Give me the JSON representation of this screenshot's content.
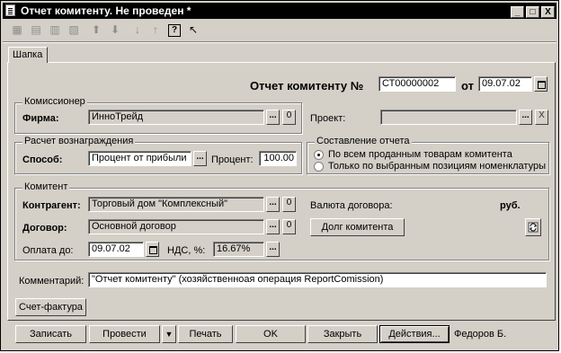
{
  "window": {
    "title": "Отчет комитенту. Не проведен *"
  },
  "title_buttons": [
    "_",
    "□",
    "X"
  ],
  "toolbar": {
    "icons": [
      "grid-icon",
      "grid-add-icon",
      "grid-copy-icon",
      "grid-delete-icon",
      "arrow-up-icon",
      "arrow-down-icon",
      "sort-asc-icon",
      "sort-desc-icon",
      "help-icon",
      "context-help-icon"
    ],
    "glyphs": [
      "▦",
      "▤",
      "▥",
      "▧",
      "⬆",
      "⬇",
      "↓",
      "↑",
      "?",
      "↖"
    ]
  },
  "tabs": {
    "main": "Шапка"
  },
  "doc": {
    "number_label": "Отчет комитенту №",
    "number": "СТ00000002",
    "from_label": "от",
    "date": "09.07.02"
  },
  "commissioner": {
    "group_label": "Комиссионер",
    "firm_label": "Фирма:",
    "firm": "ИнноТрейд",
    "project_label": "Проект:",
    "project": ""
  },
  "reward": {
    "group_label": "Расчет вознаграждения",
    "method_label": "Способ:",
    "method": "Процент от прибыли",
    "percent_label": "Процент:",
    "percent": "100.00"
  },
  "report": {
    "group_label": "Составление отчета",
    "option_all": "По всем проданным товарам комитента",
    "option_selected": "Только по выбранным позициям номенклатуры"
  },
  "principal": {
    "group_label": "Комитент",
    "counterparty_label": "Контрагент:",
    "counterparty": "Торговый дом \"Комплексный\"",
    "contract_label": "Договор:",
    "contract": "Основной договор",
    "paydue_label": "Оплата до:",
    "paydue": "09.07.02",
    "vat_label": "НДС, %:",
    "vat": "16.67%",
    "currency_label": "Валюта договора:",
    "currency": "руб.",
    "debt_button": "Долг комитента"
  },
  "comment": {
    "label": "Комментарий:",
    "value": "\"Отчет комитенту\" (хозяйственноая операция ReportComission)"
  },
  "invoice_button": "Счет-фактура",
  "buttons": {
    "save": "Записать",
    "post": "Провести",
    "print": "Печать",
    "ok": "OK",
    "close": "Закрыть",
    "actions": "Действия..."
  },
  "author": "Федоров Б.",
  "small": {
    "dots": "...",
    "zero": "0",
    "x": "X",
    "arrow": "▼"
  }
}
